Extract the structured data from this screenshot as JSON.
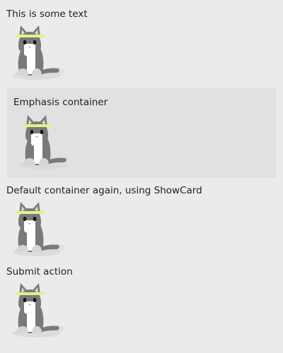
{
  "card": {
    "intro_text": "This is some text",
    "emphasis_text": "Emphasis container",
    "showcard_text": "Default container again, using ShowCard",
    "submit_text": "Submit action"
  },
  "images": [
    {
      "icon": "cat-icon"
    },
    {
      "icon": "cat-icon"
    },
    {
      "icon": "cat-icon"
    },
    {
      "icon": "cat-icon"
    }
  ],
  "colors": {
    "background": "#ebebeb",
    "emphasis_background": "#e1e1e1",
    "cat_body": "#7a7a7a",
    "cat_chest": "#ffffff",
    "headband": "#e6f08a"
  }
}
